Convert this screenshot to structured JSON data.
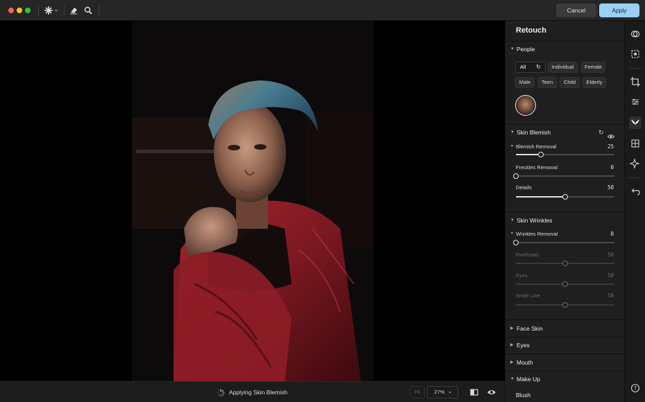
{
  "header": {
    "cancel_label": "Cancel",
    "apply_label": "Apply"
  },
  "status": {
    "text": "Applying Skin Blemish"
  },
  "view": {
    "fit_label": "Fit",
    "zoom_label": "27%"
  },
  "panel": {
    "title": "Retouch",
    "people": {
      "heading": "People",
      "filters": [
        "All",
        "Individual",
        "Female",
        "Male",
        "Teen",
        "Child",
        "Elderly"
      ]
    },
    "skin_blemish": {
      "heading": "Skin Blemish",
      "sliders": [
        {
          "label": "Blemish Removal",
          "value": 25,
          "max": 100
        },
        {
          "label": "Freckles Removal",
          "value": 0,
          "max": 100
        },
        {
          "label": "Details",
          "value": 50,
          "max": 100
        }
      ]
    },
    "skin_wrinkles": {
      "heading": "Skin Wrinkles",
      "sliders": [
        {
          "label": "Wrinkles Removal",
          "value": 0,
          "max": 100
        },
        {
          "label": "Forehead",
          "value": 50,
          "max": 100
        },
        {
          "label": "Eyes",
          "value": 50,
          "max": 100
        },
        {
          "label": "Smile Line",
          "value": 50,
          "max": 100
        }
      ]
    },
    "collapsed": {
      "face_skin": "Face Skin",
      "eyes": "Eyes",
      "mouth": "Mouth",
      "make_up": "Make Up",
      "blush": "Blush"
    }
  },
  "colors": {
    "apply_button": "#9ad0f5",
    "panel_bg": "#1f1f1f",
    "jacket_red": "#8a1c24"
  }
}
